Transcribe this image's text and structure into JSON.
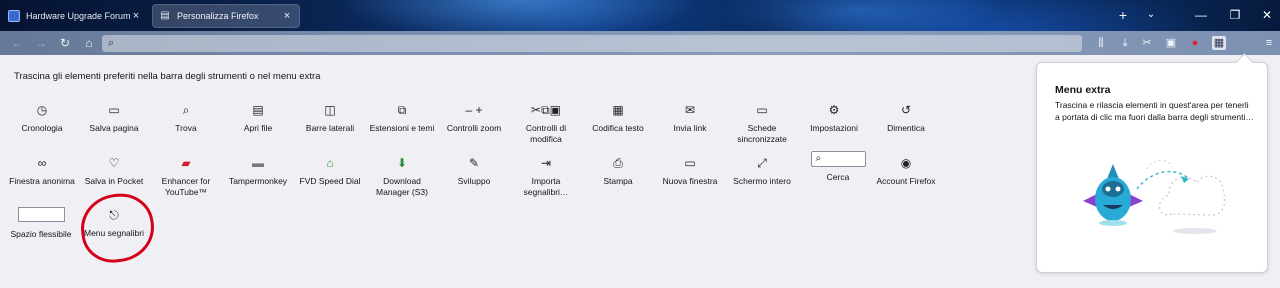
{
  "tabs": [
    {
      "title": "Hardware Upgrade Forum - Po",
      "close": "×"
    },
    {
      "title": "Personalizza Firefox",
      "close": "×"
    }
  ],
  "window": {
    "newtab": "+",
    "tablist": "⌄",
    "minimize": "—",
    "restore": "❐",
    "close": "✕"
  },
  "nav": {
    "back": "←",
    "forward": "→",
    "reload": "↻",
    "home": "⌂",
    "url_value": ""
  },
  "customize": {
    "hint": "Trascina gli elementi preferiti nella barra degli strumenti o nel menu extra",
    "items": [
      {
        "label": "Cronologia",
        "icon": "history-icon",
        "glyph": "◷"
      },
      {
        "label": "Salva pagina",
        "icon": "save-page-icon",
        "glyph": "▭"
      },
      {
        "label": "Trova",
        "icon": "find-icon",
        "glyph": "⌕"
      },
      {
        "label": "Apri file",
        "icon": "open-file-icon",
        "glyph": "▤"
      },
      {
        "label": "Barre laterali",
        "icon": "sidebar-icon",
        "glyph": "◫"
      },
      {
        "label": "Estensioni e temi",
        "icon": "addons-icon",
        "glyph": "⧉"
      },
      {
        "label": "Controlli zoom",
        "icon": "zoom-icon",
        "glyph": "–    +"
      },
      {
        "label": "Controlli di modifica",
        "icon": "edit-controls-icon",
        "glyph": "✂⧉▣"
      },
      {
        "label": "Codifica testo",
        "icon": "text-encoding-icon",
        "glyph": "▦"
      },
      {
        "label": "Invia link",
        "icon": "email-link-icon",
        "glyph": "✉"
      },
      {
        "label": "Schede sincronizzate",
        "icon": "synced-tabs-icon",
        "glyph": "▭"
      },
      {
        "label": "Impostazioni",
        "icon": "gear-icon",
        "glyph": "⚙"
      },
      {
        "label": "Dimentica",
        "icon": "forget-icon",
        "glyph": "↺"
      },
      {
        "label": "Finestra anonima",
        "icon": "private-window-icon",
        "glyph": "∞"
      },
      {
        "label": "Salva in Pocket",
        "icon": "pocket-icon",
        "glyph": "♡"
      },
      {
        "label": "Enhancer for YouTube™",
        "icon": "enhancer-youtube-icon",
        "glyph": "▰"
      },
      {
        "label": "Tampermonkey",
        "icon": "tampermonkey-icon",
        "glyph": "▬"
      },
      {
        "label": "FVD Speed Dial",
        "icon": "speed-dial-icon",
        "glyph": "⌂"
      },
      {
        "label": "Download Manager (S3)",
        "icon": "download-manager-icon",
        "glyph": "⬇"
      },
      {
        "label": "Sviluppo",
        "icon": "wrench-icon",
        "glyph": "🔧"
      },
      {
        "label": "Importa segnalibri…",
        "icon": "import-bookmarks-icon",
        "glyph": "⇥"
      },
      {
        "label": "Stampa",
        "icon": "print-icon",
        "glyph": "⎙"
      },
      {
        "label": "Nuova finestra",
        "icon": "new-window-icon",
        "glyph": "▭"
      },
      {
        "label": "Schermo intero",
        "icon": "fullscreen-icon",
        "glyph": "⤢"
      },
      {
        "label": "Cerca",
        "icon": "search-icon",
        "glyph": "⌕"
      },
      {
        "label": "Account Firefox",
        "icon": "account-icon",
        "glyph": "◉"
      },
      {
        "label": "Spazio flessibile",
        "icon": "flexible-space-icon",
        "glyph": ""
      },
      {
        "label": "Menu segnalibri",
        "icon": "bookmarks-menu-icon",
        "glyph": "⎋"
      }
    ]
  },
  "overflow_panel": {
    "title": "Menu extra",
    "text": "Trascina e rilascia elementi in quest'area per tenerli a portata di clic ma fuori dalla barra degli strumenti…"
  },
  "colors": {
    "annotation_ring": "#d4001a",
    "panel_bg": "#ffffff",
    "page_bg": "#f0f0f4"
  }
}
